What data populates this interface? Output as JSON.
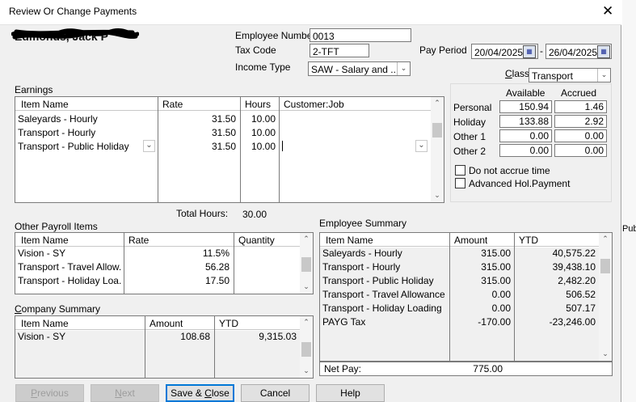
{
  "window": {
    "title": "Review Or Change Payments"
  },
  "employee": {
    "name": "Edmonds, Jack P",
    "number_label": "Employee Number",
    "number": "0013",
    "tax_code_label": "Tax Code",
    "tax_code": "2-TFT",
    "income_type_label": "Income Type",
    "income_type": "SAW - Salary and ..."
  },
  "pay_period": {
    "label": "Pay Period",
    "start": "20/04/2025",
    "end": "26/04/2025",
    "separator": "-"
  },
  "class_field": {
    "label": "Class",
    "value": "Transport"
  },
  "earnings": {
    "label": "Earnings",
    "headers": [
      "Item Name",
      "Rate",
      "Hours",
      "Customer:Job"
    ],
    "rows": [
      {
        "item": "Saleyards - Hourly",
        "rate": "31.50",
        "hours": "10.00",
        "job": ""
      },
      {
        "item": "Transport - Hourly",
        "rate": "31.50",
        "hours": "10.00",
        "job": ""
      },
      {
        "item": "Transport - Public Holiday",
        "rate": "31.50",
        "hours": "10.00",
        "job": ""
      }
    ],
    "total_hours_label": "Total Hours:",
    "total_hours": "30.00"
  },
  "accruals": {
    "available_label": "Available",
    "accrued_label": "Accrued",
    "rows": [
      {
        "label": "Personal",
        "available": "150.94",
        "accrued": "1.46"
      },
      {
        "label": "Holiday",
        "available": "133.88",
        "accrued": "2.92"
      },
      {
        "label": "Other 1",
        "available": "0.00",
        "accrued": "0.00"
      },
      {
        "label": "Other 2",
        "available": "0.00",
        "accrued": "0.00"
      }
    ],
    "do_not_accrue_label": "Do not accrue time",
    "advanced_hol_label": "Advanced Hol.Payment"
  },
  "other_payroll": {
    "label": "Other Payroll Items",
    "headers": [
      "Item Name",
      "Rate",
      "Quantity"
    ],
    "rows": [
      {
        "item": "Vision - SY",
        "rate": "11.5%",
        "qty": ""
      },
      {
        "item": "Transport - Travel Allow...",
        "rate": "56.28",
        "qty": ""
      },
      {
        "item": "Transport - Holiday Loa...",
        "rate": "17.50",
        "qty": ""
      }
    ]
  },
  "company_summary": {
    "label": "Company Summary",
    "headers": [
      "Item Name",
      "Amount",
      "YTD"
    ],
    "rows": [
      {
        "item": "Vision - SY",
        "amount": "108.68",
        "ytd": "9,315.03"
      }
    ]
  },
  "employee_summary": {
    "label": "Employee Summary",
    "headers": [
      "Item Name",
      "Amount",
      "YTD"
    ],
    "rows": [
      {
        "item": "Saleyards - Hourly",
        "amount": "315.00",
        "ytd": "40,575.22"
      },
      {
        "item": "Transport - Hourly",
        "amount": "315.00",
        "ytd": "39,438.10"
      },
      {
        "item": "Transport - Public Holiday",
        "amount": "315.00",
        "ytd": "2,482.20"
      },
      {
        "item": "Transport - Travel Allowance",
        "amount": "0.00",
        "ytd": "506.52"
      },
      {
        "item": "Transport - Holiday Loading",
        "amount": "0.00",
        "ytd": "507.17"
      },
      {
        "item": "PAYG Tax",
        "amount": "-170.00",
        "ytd": "-23,246.00"
      }
    ],
    "net_pay_label": "Net Pay:",
    "net_pay": "775.00"
  },
  "buttons": {
    "previous": "Previous",
    "next": "Next",
    "save_close": "Save & Close",
    "cancel": "Cancel",
    "help": "Help"
  },
  "background": {
    "right_text": "Publ"
  },
  "icons": {
    "close": "close-icon",
    "calendar": "calendar-icon",
    "dropdown": "chevron-down-icon",
    "scroll_up": "scroll-up-icon",
    "scroll_down": "scroll-down-icon"
  }
}
